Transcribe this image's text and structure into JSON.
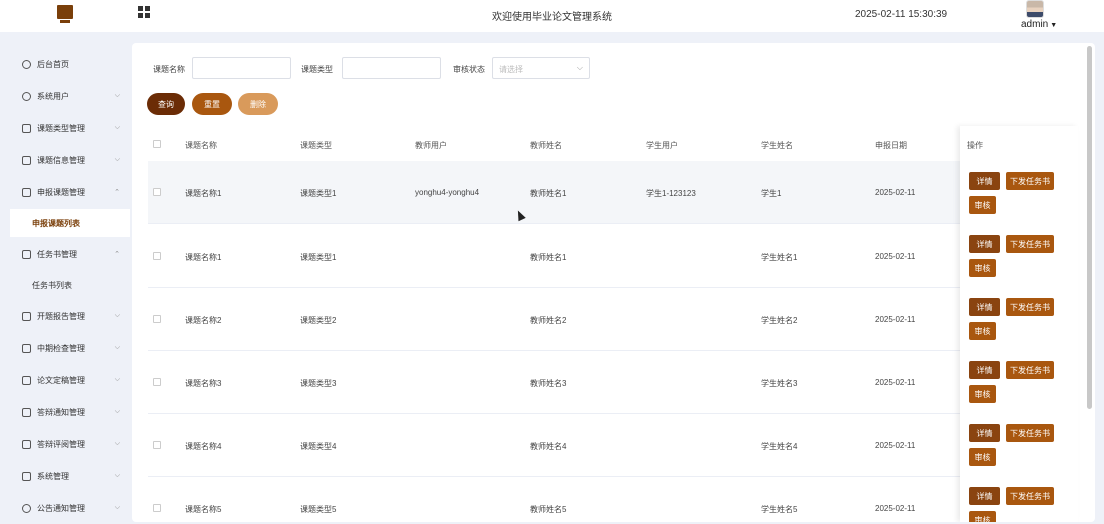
{
  "header": {
    "title": "欢迎使用毕业论文管理系统",
    "datetime": "2025-02-11 15:30:39",
    "user": "admin",
    "logo_icon": "monitor-icon",
    "menu_icon": "grid-icon"
  },
  "sidebar": {
    "items": [
      {
        "label": "后台首页",
        "icon": "clock-icon",
        "has_chevron": false
      },
      {
        "label": "系统用户",
        "icon": "user-icon",
        "has_chevron": true
      },
      {
        "label": "课题类型管理",
        "icon": "mail-icon",
        "has_chevron": true
      },
      {
        "label": "课题信息管理",
        "icon": "mail-icon",
        "has_chevron": true
      },
      {
        "label": "申报课题管理",
        "icon": "mail-icon",
        "has_chevron": true,
        "expanded": true
      },
      {
        "label": "申报课题列表",
        "submenu": true,
        "active": true
      },
      {
        "label": "任务书管理",
        "icon": "mail-icon",
        "has_chevron": true,
        "expanded": true
      },
      {
        "label": "任务书列表",
        "submenu": true
      },
      {
        "label": "开题报告管理",
        "icon": "mail-icon",
        "has_chevron": true
      },
      {
        "label": "中期检查管理",
        "icon": "mail-icon",
        "has_chevron": true
      },
      {
        "label": "论文定稿管理",
        "icon": "mail-icon",
        "has_chevron": true
      },
      {
        "label": "答辩通知管理",
        "icon": "mail-icon",
        "has_chevron": true
      },
      {
        "label": "答辩评阅管理",
        "icon": "mail-icon",
        "has_chevron": true
      },
      {
        "label": "系统管理",
        "icon": "folder-icon",
        "has_chevron": true
      },
      {
        "label": "公告通知管理",
        "icon": "bell-icon",
        "has_chevron": true
      }
    ]
  },
  "filters": {
    "topic_name_label": "课题名称",
    "topic_type_label": "课题类型",
    "review_status_label": "审核状态",
    "review_status_placeholder": "请选择",
    "topic_name_value": "",
    "topic_type_value": ""
  },
  "buttons": {
    "query": "查询",
    "reset": "重置",
    "delete": "删除"
  },
  "table": {
    "columns": [
      "课题名称",
      "课题类型",
      "教师用户",
      "教师姓名",
      "学生用户",
      "学生姓名",
      "申报日期",
      "操作"
    ],
    "rows": [
      {
        "name": "课题名称1",
        "type": "课题类型1",
        "teacher_user": "yonghu4-yonghu4",
        "teacher_name": "教师姓名1",
        "student_user": "学生1-123123",
        "student_name": "学生1",
        "date": "2025-02-11"
      },
      {
        "name": "课题名称1",
        "type": "课题类型1",
        "teacher_user": "",
        "teacher_name": "教师姓名1",
        "student_user": "",
        "student_name": "学生姓名1",
        "date": "2025-02-11"
      },
      {
        "name": "课题名称2",
        "type": "课题类型2",
        "teacher_user": "",
        "teacher_name": "教师姓名2",
        "student_user": "",
        "student_name": "学生姓名2",
        "date": "2025-02-11"
      },
      {
        "name": "课题名称3",
        "type": "课题类型3",
        "teacher_user": "",
        "teacher_name": "教师姓名3",
        "student_user": "",
        "student_name": "学生姓名3",
        "date": "2025-02-11"
      },
      {
        "name": "课题名称4",
        "type": "课题类型4",
        "teacher_user": "",
        "teacher_name": "教师姓名4",
        "student_user": "",
        "student_name": "学生姓名4",
        "date": "2025-02-11"
      },
      {
        "name": "课题名称5",
        "type": "课题类型5",
        "teacher_user": "",
        "teacher_name": "教师姓名5",
        "student_user": "",
        "student_name": "学生姓名5",
        "date": "2025-02-11"
      }
    ],
    "ops": {
      "detail": "详情",
      "issue": "下发任务书",
      "review": "审核"
    }
  },
  "colors": {
    "primary": "#6b2c06",
    "accent": "#a9570f",
    "light": "#d99a5b",
    "background": "#eef1f8"
  }
}
